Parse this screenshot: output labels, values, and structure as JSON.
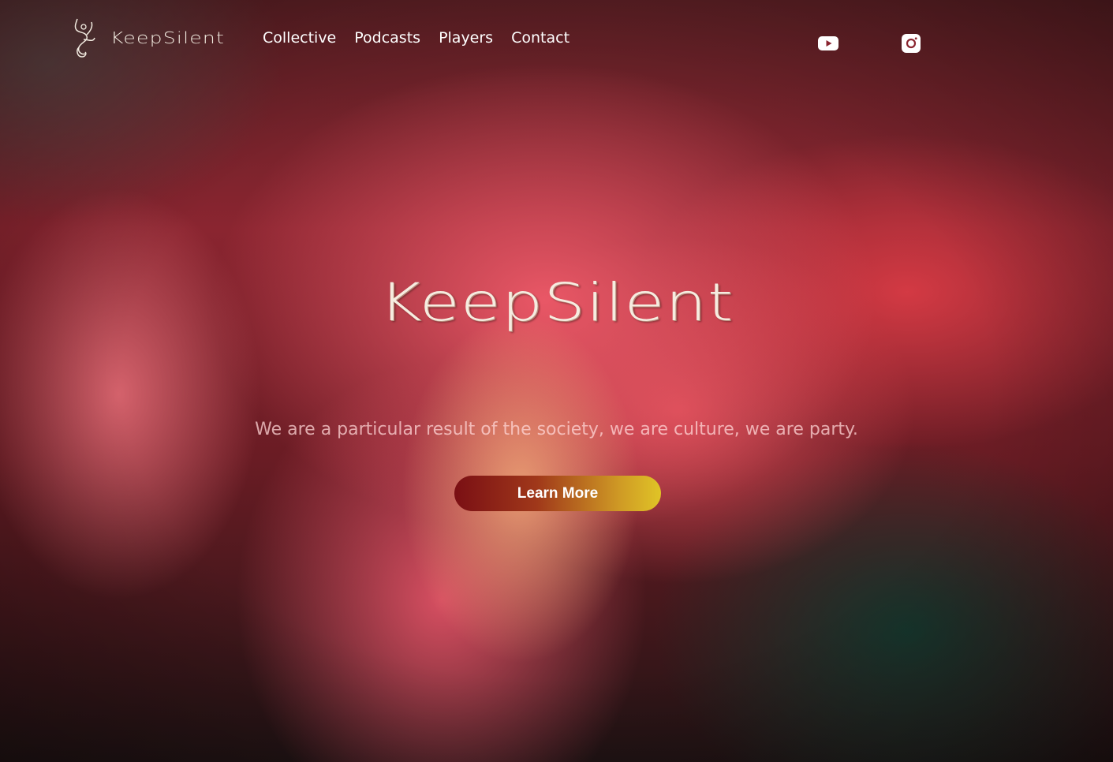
{
  "header": {
    "logo_text": "KeepSilent",
    "nav": [
      {
        "label": "Collective"
      },
      {
        "label": "Podcasts"
      },
      {
        "label": "Players"
      },
      {
        "label": "Contact"
      }
    ],
    "social": [
      {
        "icon": "youtube-icon"
      },
      {
        "icon": "instagram-icon"
      }
    ]
  },
  "hero": {
    "title": "KeepSilent",
    "tagline": "We are a particular result of the society, we are culture, we are party.",
    "cta_label": "Learn More"
  },
  "colors": {
    "text_light": "#f6ece0",
    "cta_gradient_start": "#7a0f14",
    "cta_gradient_end": "#e0c426"
  }
}
